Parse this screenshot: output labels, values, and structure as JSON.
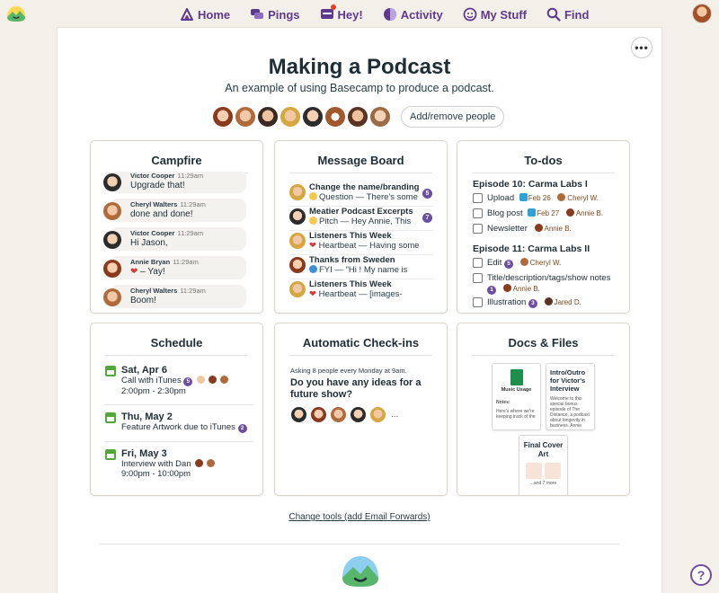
{
  "nav": {
    "items": [
      {
        "label": "Home",
        "icon": "home-icon"
      },
      {
        "label": "Pings",
        "icon": "pings-icon"
      },
      {
        "label": "Hey!",
        "icon": "hey-icon"
      },
      {
        "label": "Activity",
        "icon": "activity-icon"
      },
      {
        "label": "My Stuff",
        "icon": "my-stuff-icon"
      },
      {
        "label": "Find",
        "icon": "search-icon"
      }
    ]
  },
  "project": {
    "title": "Making a Podcast",
    "subtitle": "An example of using Basecamp to produce a podcast.",
    "add_people_label": "Add/remove people",
    "more_label": "•••"
  },
  "campfire": {
    "title": "Campfire",
    "lines": [
      {
        "author": "Victor Cooper",
        "time": "11:29am",
        "text": "Upgrade that!"
      },
      {
        "author": "Cheryl Walters",
        "time": "11:29am",
        "text": "done and done!"
      },
      {
        "author": "Victor Cooper",
        "time": "11:29am",
        "text": "Hi Jason,"
      },
      {
        "author": "Annie Bryan",
        "time": "11:29am",
        "text": "– Yay!"
      },
      {
        "author": "Cheryl Walters",
        "time": "11:29am",
        "text": "Boom!"
      }
    ]
  },
  "message_board": {
    "title": "Message Board",
    "messages": [
      {
        "subject": "Change the name/branding",
        "excerpt": "Question — There's some",
        "count": "5"
      },
      {
        "subject": "Meatier Podcast Excerpts",
        "excerpt": "Pitch — Hey Annie, This",
        "count": "7"
      },
      {
        "subject": "Listeners This Week",
        "excerpt": "Heartbeat — Having some",
        "count": ""
      },
      {
        "subject": "Thanks from Sweden",
        "excerpt": "FYI — \"Hi ! My name is",
        "count": ""
      },
      {
        "subject": "Listeners This Week",
        "excerpt": "Heartbeat — [images-",
        "count": ""
      }
    ]
  },
  "todos": {
    "title": "To-dos",
    "lists": [
      {
        "name": "Episode 10: Carma Labs I",
        "items": [
          {
            "text": "Upload",
            "date": "Feb 26",
            "assignee": "Cheryl W.",
            "badge": ""
          },
          {
            "text": "Blog post",
            "date": "Feb 27",
            "assignee": "Annie B.",
            "badge": ""
          },
          {
            "text": "Newsletter",
            "date": "",
            "assignee": "Annie B.",
            "badge": ""
          }
        ]
      },
      {
        "name": "Episode 11: Carma Labs II",
        "items": [
          {
            "text": "Edit",
            "date": "",
            "assignee": "Cheryl W.",
            "badge": "5"
          },
          {
            "text": "Title/description/tags/show notes",
            "date": "",
            "assignee": "Annie B.",
            "badge": "1"
          },
          {
            "text": "Illustration",
            "date": "",
            "assignee": "Jared D.",
            "badge": "3"
          }
        ]
      }
    ]
  },
  "schedule": {
    "title": "Schedule",
    "events": [
      {
        "date": "Sat, Apr 6",
        "name": "Call with iTunes",
        "badge": "5",
        "time": "2:00pm - 2:30pm"
      },
      {
        "date": "Thu, May 2",
        "name": "Feature Artwork due to iTunes",
        "badge": "2",
        "time": ""
      },
      {
        "date": "Fri, May 3",
        "name": "Interview with Dan",
        "badge": "",
        "time": "9:00pm - 10:00pm"
      }
    ]
  },
  "checkins": {
    "title": "Automatic Check-ins",
    "ask": "Asking 8 people every Monday at 9am.",
    "question": "Do you have any ideas for a future show?",
    "more": "..."
  },
  "docs": {
    "title": "Docs & Files",
    "files": [
      {
        "title": "Music Usage",
        "note_label": "Notes:",
        "note": "Here's where we're keeping track of the"
      },
      {
        "title": "Intro/Outro for Victor's Interview",
        "note": "Welcome to this special bonus episode of The Distance, a podcast about longevity in business. Annie"
      },
      {
        "title": "Final Cover Art",
        "note": "...and 7 more"
      }
    ]
  },
  "footer": {
    "change_tools": "Change tools (add Email Forwards)",
    "help": "?"
  },
  "colors": {
    "accent": "#5d3a8e",
    "badge": "#6c4ea0",
    "background": "#f3efe9",
    "brand_green": "#53a83b"
  }
}
